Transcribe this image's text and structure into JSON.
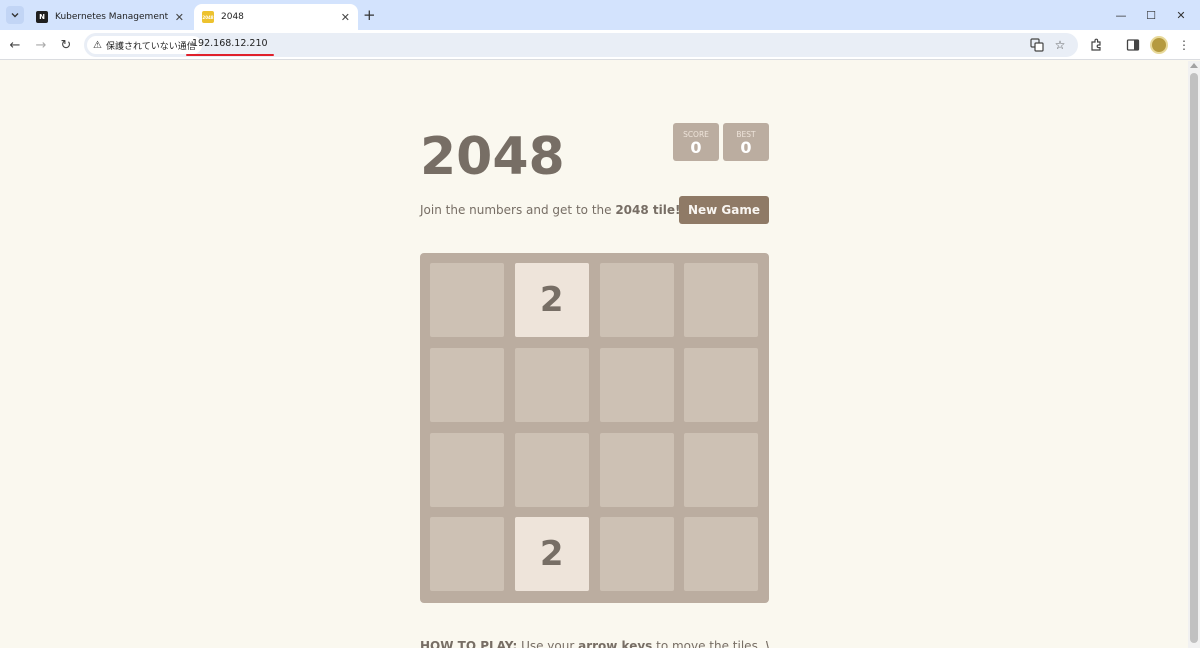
{
  "browser": {
    "tabs": [
      {
        "title": "Kubernetes Management - Nut",
        "active": false
      },
      {
        "title": "2048",
        "active": true
      }
    ],
    "security_label": "保護されていない通信",
    "url": "192.168.12.210"
  },
  "game": {
    "title": "2048",
    "score_label": "SCORE",
    "score": "0",
    "best_label": "BEST",
    "best": "0",
    "intro_prefix": "Join the numbers and get to the ",
    "intro_bold": "2048 tile!",
    "new_game_label": "New Game",
    "grid": [
      [
        null,
        2,
        null,
        null
      ],
      [
        null,
        null,
        null,
        null
      ],
      [
        null,
        null,
        null,
        null
      ],
      [
        null,
        2,
        null,
        null
      ]
    ],
    "howto_bold": "HOW TO PLAY:",
    "howto_text1": " Use your ",
    "howto_bold2": "arrow keys",
    "howto_text2": " to move the tiles. When"
  },
  "colors": {
    "background": "#faf8ef",
    "board": "#bbada0",
    "cell": "#cdc1b4",
    "tile_2": "#eee4da",
    "text": "#776e65",
    "button": "#8f7a66"
  }
}
